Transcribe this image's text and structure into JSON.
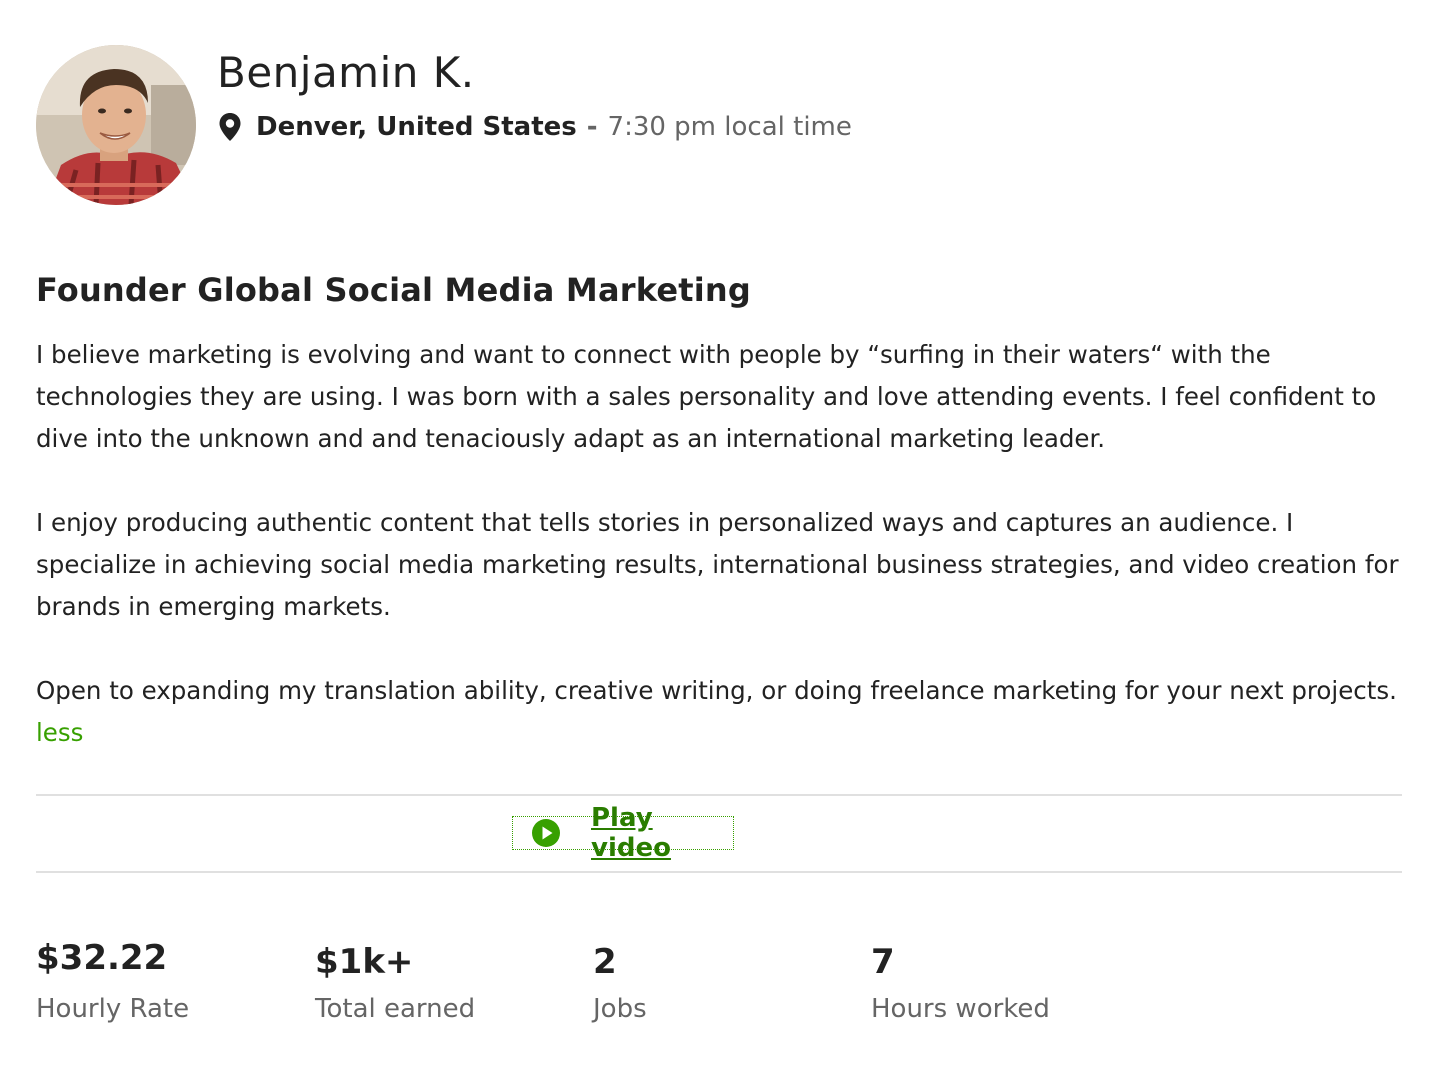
{
  "profile": {
    "name": "Benjamin K.",
    "location": "Denver, United States",
    "separator": "-",
    "local_time": "7:30 pm local time",
    "avatar_icon": "avatar-photo"
  },
  "overview": {
    "title": "Founder Global Social Media Marketing",
    "paragraphs": [
      "I believe marketing is evolving and want to connect with people by “surfing in their waters“ with the technologies they are using. I was born with a sales personality and love attending events. I feel confident to dive into the unknown and and tenaciously adapt as an international marketing leader.",
      "I enjoy producing authentic content that tells stories in personalized ways and captures an audience. I specialize in achieving social media marketing results, international business strategies, and video creation for brands in emerging markets.",
      "Open to expanding my translation ability, creative writing, or doing freelance marketing for your next projects."
    ],
    "less_label": "less"
  },
  "video": {
    "label": "Play video",
    "icon": "play-circle-icon"
  },
  "stats": [
    {
      "value": "$32.22",
      "label": "Hourly Rate"
    },
    {
      "value": "$1k+",
      "label": "Total earned"
    },
    {
      "value": "2",
      "label": "Jobs"
    },
    {
      "value": "7",
      "label": "Hours worked"
    }
  ],
  "colors": {
    "accent": "#37a000",
    "text": "#222222",
    "muted": "#656565",
    "divider": "#e0e0e0"
  }
}
